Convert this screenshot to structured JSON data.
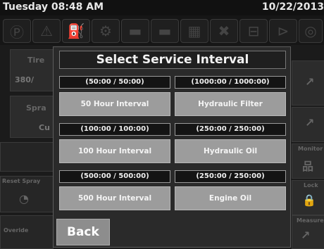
{
  "status_bar": {
    "datetime": "Tuesday 08:48 AM",
    "date": "10/22/2013"
  },
  "toolbar_icons": [
    "parking-brake-icon",
    "warning-icon",
    "fuel-filter-icon",
    "engine-icon",
    "hydraulic-icon",
    "oil-icon",
    "radiator-icon",
    "no-spray-icon",
    "hopper-icon",
    "pump-icon",
    "valve-icon"
  ],
  "background": {
    "tire_label": "Tire",
    "tire_value": "380/",
    "spray_label": "Spra",
    "spray_value": "Cu",
    "bottom_left_label": "Reset Spray",
    "bottom_left_label2": "Overide",
    "right_labels": [
      "Monitor",
      "Lock",
      "Measure"
    ]
  },
  "dialog": {
    "title": "Select Service Interval",
    "rows": [
      {
        "left_hours": "(50:00 / 50:00)",
        "left_label": "50 Hour Interval",
        "right_hours": "(1000:00 / 1000:00)",
        "right_label": "Hydraulic Filter"
      },
      {
        "left_hours": "(100:00 / 100:00)",
        "left_label": "100 Hour Interval",
        "right_hours": "(250:00 / 250:00)",
        "right_label": "Hydraulic Oil"
      },
      {
        "left_hours": "(500:00 / 500:00)",
        "left_label": "500 Hour Interval",
        "right_hours": "(250:00 / 250:00)",
        "right_label": "Engine Oil"
      }
    ],
    "back_label": "Back"
  }
}
